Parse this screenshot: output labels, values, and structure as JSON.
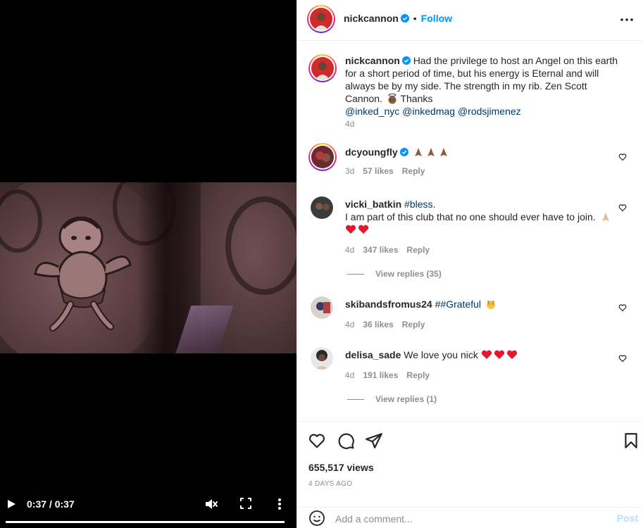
{
  "video": {
    "time": "0:37 / 0:37",
    "progress": 1.0
  },
  "header": {
    "username": "nickcannon",
    "follow": "Follow",
    "separator": "•"
  },
  "caption": {
    "username": "nickcannon",
    "text": "Had the privilege to host an Angel on this earth for a short period of time, but his energy is Eternal and will always be by my side. The strength in my rib. Zen Scott Cannon.",
    "thanks": "Thanks",
    "mentions": [
      "@inked_nyc",
      "@inkedmag",
      "@rodsjimenez"
    ],
    "age": "4d"
  },
  "comments": [
    {
      "username": "dcyoungfly",
      "text": "",
      "age": "3d",
      "likes": "57 likes",
      "reply": "Reply"
    },
    {
      "username": "vicki_batkin",
      "hashtag": "#bless.",
      "text": "I am part of this club that no one should ever have to join.",
      "age": "4d",
      "likes": "347 likes",
      "reply": "Reply",
      "view_replies": "View replies (35)"
    },
    {
      "username": "skibandsfromus24",
      "prefix": "#",
      "hashtag": "#Grateful",
      "age": "4d",
      "likes": "36 likes",
      "reply": "Reply"
    },
    {
      "username": "delisa_sade",
      "text": "We love you nick",
      "age": "4d",
      "likes": "191 likes",
      "reply": "Reply",
      "view_replies": "View replies (1)"
    }
  ],
  "stats": {
    "views": "655,517 views",
    "date": "4 DAYS AGO"
  },
  "comment_box": {
    "placeholder": "Add a comment...",
    "post": "Post"
  },
  "colors": {
    "accent": "#0095f6",
    "mention": "#00376b",
    "muted": "#8e8e8e",
    "post_disabled": "#b2dffc"
  }
}
